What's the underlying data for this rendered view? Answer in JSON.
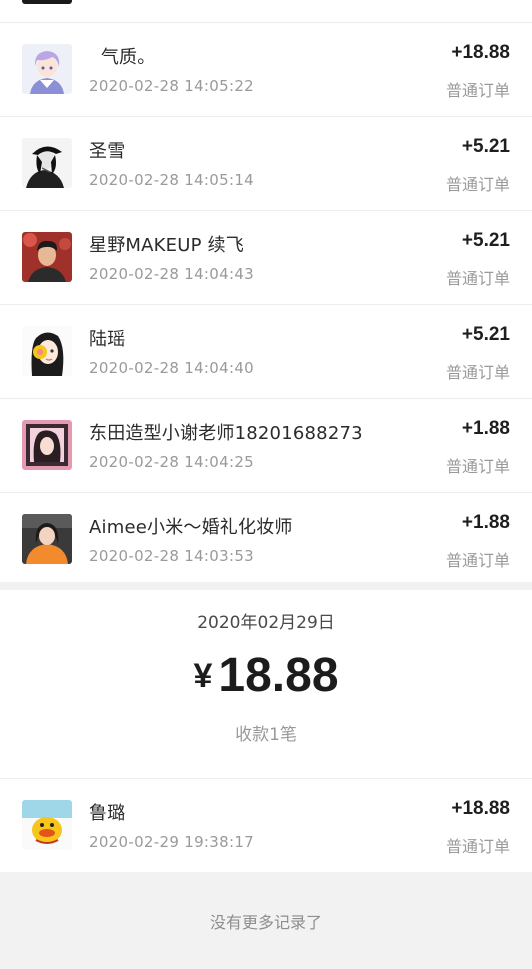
{
  "records_feb28": [
    {
      "name": "  气质。",
      "time": "2020-02-28 14:05:22",
      "amount": "+18.88",
      "type": "普通订单",
      "avatar": "anime-boy-avatar"
    },
    {
      "name": "圣雪",
      "time": "2020-02-28 14:05:14",
      "amount": "+5.21",
      "type": "普通订单",
      "avatar": "bw-girl-hat-avatar"
    },
    {
      "name": "星野MAKEUP 续飞",
      "time": "2020-02-28 14:04:43",
      "amount": "+5.21",
      "type": "普通订单",
      "avatar": "young-man-avatar"
    },
    {
      "name": "陆瑶",
      "time": "2020-02-28 14:04:40",
      "amount": "+5.21",
      "type": "普通订单",
      "avatar": "drawn-girl-avatar"
    },
    {
      "name": "东田造型小谢老师18201688273",
      "time": "2020-02-28 14:04:25",
      "amount": "+1.88",
      "type": "普通订单",
      "avatar": "pink-frame-girl-avatar"
    },
    {
      "name": "Aimee小米～婚礼化妆师",
      "time": "2020-02-28 14:03:53",
      "amount": "+1.88",
      "type": "普通订单",
      "avatar": "orange-sweater-avatar"
    }
  ],
  "summary_feb29": {
    "date": "2020年02月29日",
    "currency": "¥",
    "total": "18.88",
    "count_text": "收款1笔"
  },
  "records_feb29": [
    {
      "name": "鲁璐",
      "time": "2020-02-29 19:38:17",
      "amount": "+18.88",
      "type": "普通订单",
      "avatar": "duck-cartoon-avatar"
    }
  ],
  "footer": {
    "text": "没有更多记录了"
  }
}
